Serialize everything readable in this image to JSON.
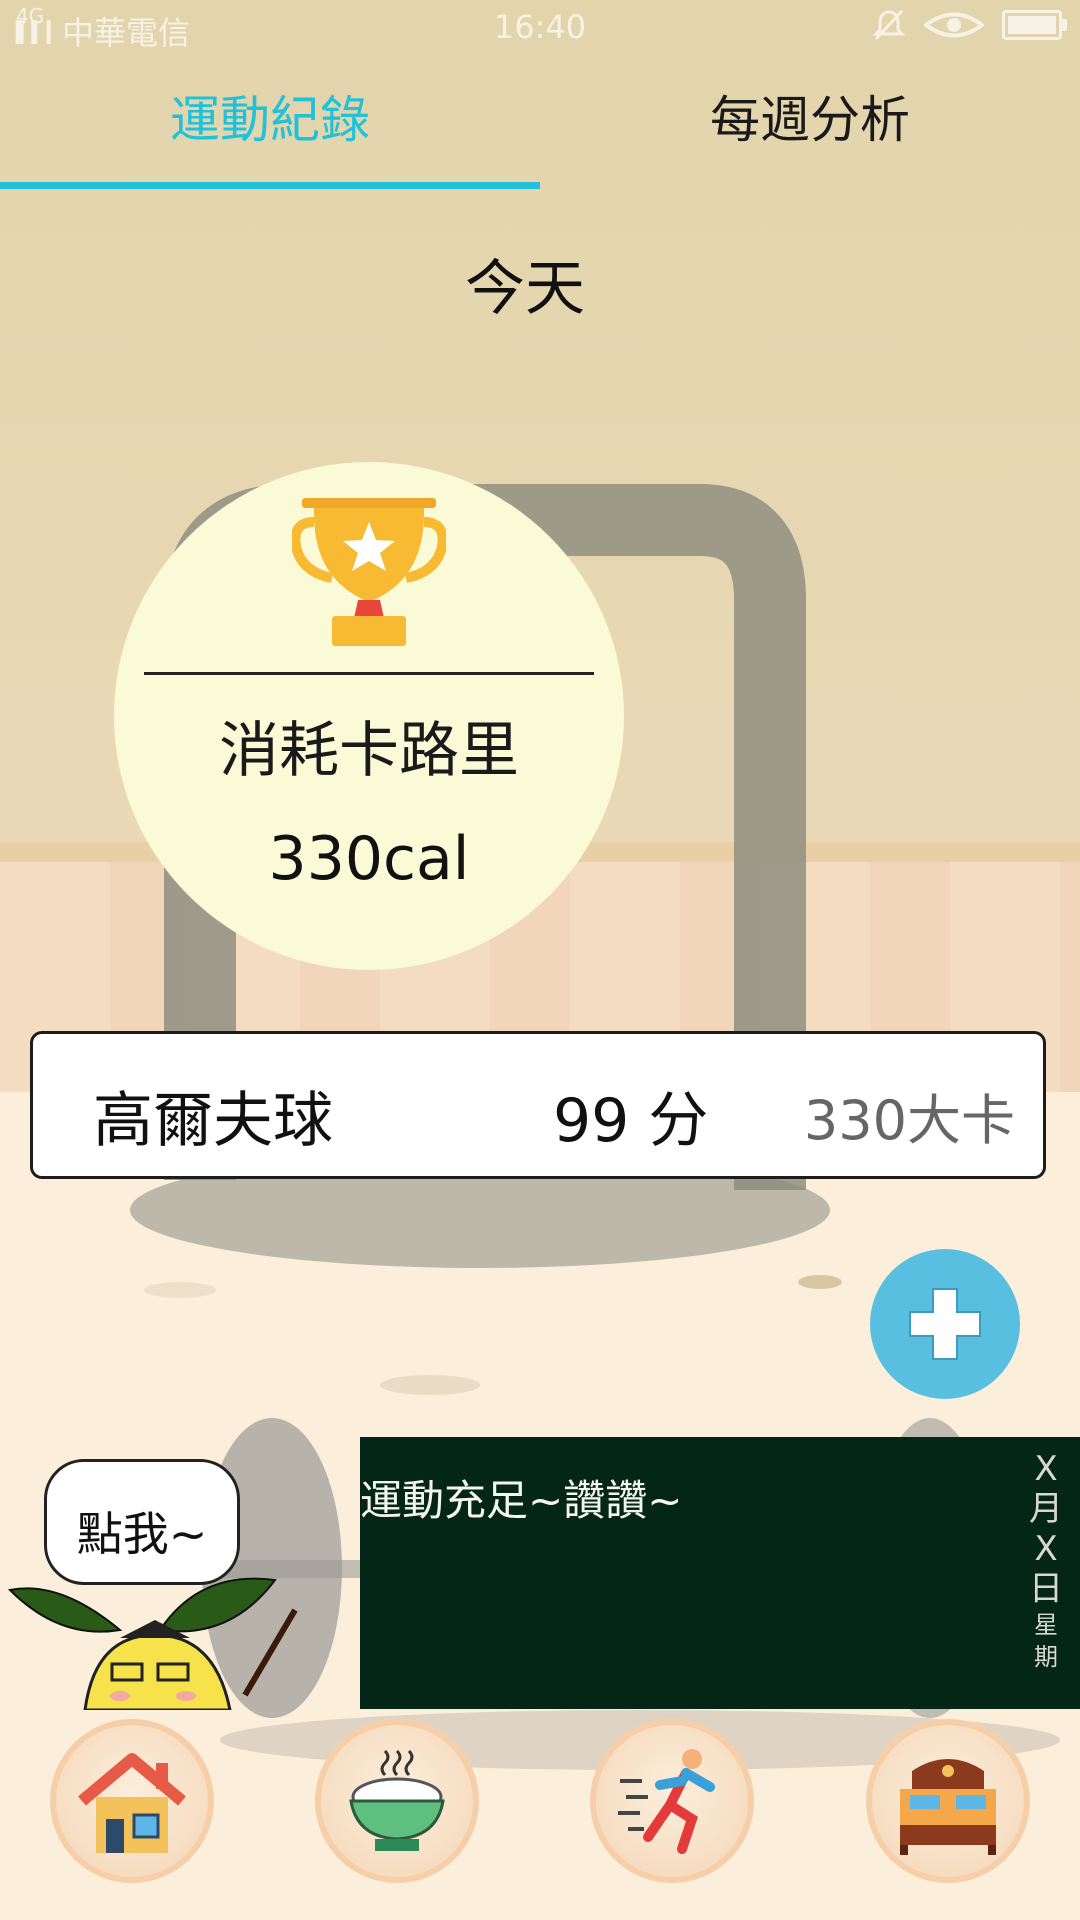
{
  "status_bar": {
    "signal_text": "4G",
    "carrier": "中華電信",
    "time": "16:40",
    "battery_level": 1.0
  },
  "tabs": [
    {
      "label": "運動紀錄",
      "active": true
    },
    {
      "label": "每週分析",
      "active": false
    }
  ],
  "day_title": "今天",
  "summary": {
    "icon": "trophy-icon",
    "label": "消耗卡路里",
    "value": "330cal"
  },
  "records": [
    {
      "name": "高爾夫球",
      "score": "99 分",
      "calories": "330大卡"
    }
  ],
  "add_button": {
    "icon": "plus-icon"
  },
  "chalkboard": {
    "message": "運動充足~讚讚~",
    "date_chars": [
      "X",
      "月",
      "X",
      "日"
    ],
    "weekday_chars": [
      "星",
      "期"
    ]
  },
  "mascot": {
    "bubble_text": "點我~"
  },
  "bottom_nav": [
    {
      "icon": "house-icon"
    },
    {
      "icon": "rice-bowl-icon"
    },
    {
      "icon": "running-person-icon"
    },
    {
      "icon": "bed-icon"
    }
  ],
  "colors": {
    "accent": "#21c1da",
    "circle_bg": "#fafad6",
    "fab": "#58bfe0",
    "chalkboard": "#032617"
  }
}
